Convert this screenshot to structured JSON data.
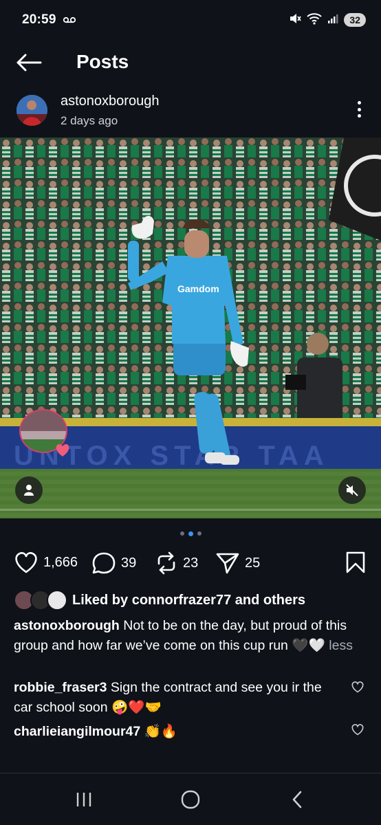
{
  "status_bar": {
    "time": "20:59",
    "battery": "32"
  },
  "header": {
    "title": "Posts"
  },
  "post": {
    "username": "astonoxborough",
    "time_ago": "2 days ago",
    "carousel": {
      "count": 3,
      "active_index": 1
    },
    "likes": "1,666",
    "comments": "39",
    "reposts": "23",
    "shares": "25",
    "liked_by_prefix": "Liked by ",
    "liked_by_user": "connorfrazer77",
    "liked_by_suffix": " and others",
    "caption": {
      "username": "astonoxborough",
      "text": " Not to be on the day, but proud of this group and how far we’ve come on this cup run 🖤🤍",
      "less_label": " less"
    },
    "comments_list": [
      {
        "username": "robbie_fraser3",
        "text": " Sign the contract and see you ir the car school soon 🤪❤️🤝"
      },
      {
        "username": "charlieiangilmour47",
        "text": " 👏🔥"
      }
    ]
  },
  "colors": {
    "background": "#0f1219",
    "accent": "#3897f0",
    "story_ring": "#dd3b6a"
  }
}
